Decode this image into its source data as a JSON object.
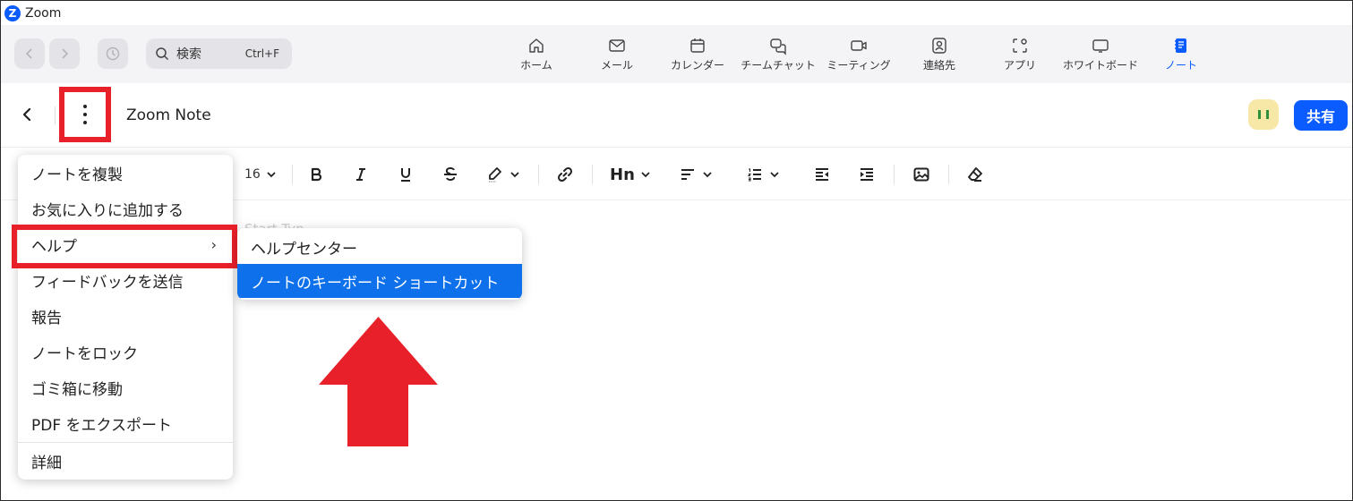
{
  "window": {
    "app_title": "Zoom",
    "logo_letter": "Z"
  },
  "topbar": {
    "search_label": "検索",
    "search_shortcut": "Ctrl+F",
    "nav": [
      {
        "label": "ホーム",
        "icon": "home-icon"
      },
      {
        "label": "メール",
        "icon": "mail-icon"
      },
      {
        "label": "カレンダー",
        "icon": "calendar-icon"
      },
      {
        "label": "チームチャット",
        "icon": "chat-icon"
      },
      {
        "label": "ミーティング",
        "icon": "video-icon"
      },
      {
        "label": "連絡先",
        "icon": "contacts-icon"
      },
      {
        "label": "アプリ",
        "icon": "apps-icon"
      },
      {
        "label": "ホワイトボード",
        "icon": "whiteboard-icon"
      },
      {
        "label": "ノート",
        "icon": "notes-icon",
        "active": true
      }
    ]
  },
  "note": {
    "title": "Zoom Note",
    "share_label": "共有",
    "placeholder": "Start Typ..."
  },
  "toolbar": {
    "font_size": "16",
    "heading_label": "Hn"
  },
  "menu": {
    "items": [
      {
        "label": "ノートを複製"
      },
      {
        "label": "お気に入りに追加する"
      },
      {
        "label": "ヘルプ",
        "has_submenu": true,
        "submenu_arrow": "›"
      },
      {
        "label": "フィードバックを送信"
      },
      {
        "label": "報告"
      },
      {
        "label": "ノートをロック"
      },
      {
        "label": "ゴミ箱に移動"
      },
      {
        "label": "PDF をエクスポート"
      },
      {
        "label": "詳細"
      }
    ]
  },
  "submenu": {
    "items": [
      {
        "label": "ヘルプセンター"
      },
      {
        "label": "ノートのキーボード ショートカット",
        "selected": true
      }
    ]
  },
  "colors": {
    "accent": "#0b5cff",
    "highlight_red": "#e8202a",
    "selected_item": "#0e71eb"
  }
}
